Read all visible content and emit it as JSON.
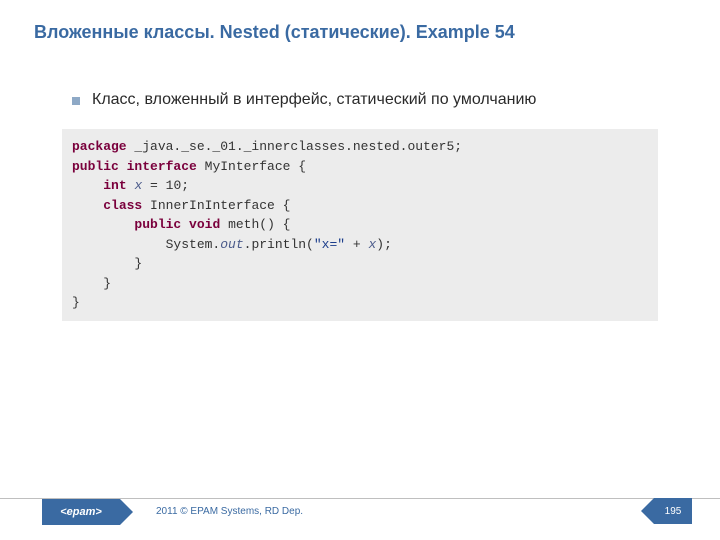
{
  "title": "Вложенные классы. Nested (статические). Example 54",
  "bullet": "Класс, вложенный в интерфейс, статический по умолчанию",
  "code": {
    "kw_package": "package",
    "pkg_name": " _java._se._01._innerclasses.nested.outer5;",
    "kw_public1": "public",
    "kw_interface": "interface",
    "iface_name": " MyInterface {",
    "kw_int": "int",
    "fld_x": "x",
    "x_assign": " = 10;",
    "kw_class": "class",
    "inner_name": " InnerInInterface {",
    "kw_public2": "public",
    "kw_void": "void",
    "meth_sig": " meth() {",
    "sysout_pre": "            System.",
    "fld_out": "out",
    "print_open": ".println(",
    "str_lit": "\"x=\"",
    "plus": " + ",
    "fld_x2": "x",
    "print_close": ");",
    "close1": "        }",
    "close2": "    }",
    "close3": "}"
  },
  "footer": {
    "logo": "<epam>",
    "copyright": "2011 © EPAM Systems, RD Dep.",
    "page": "195"
  }
}
